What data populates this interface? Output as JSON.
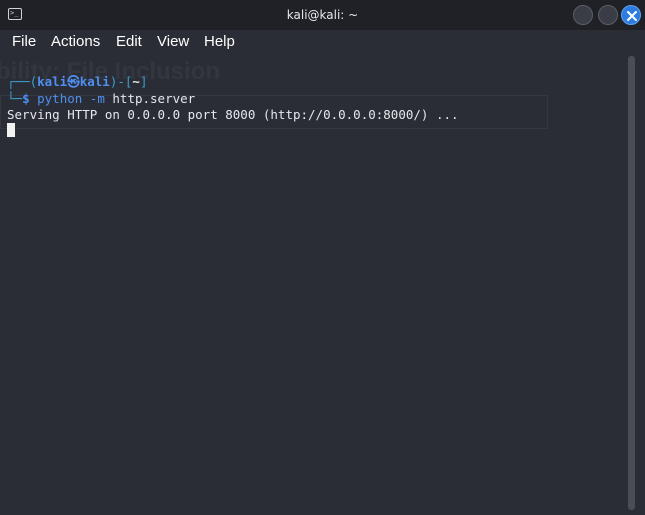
{
  "window": {
    "title": "kali@kali: ~",
    "buttons": {
      "minimize": "minimize-icon",
      "maximize": "maximize-icon",
      "close": "close-icon"
    }
  },
  "menu": {
    "file": "File",
    "actions": "Actions",
    "edit": "Edit",
    "view": "View",
    "help": "Help"
  },
  "background": {
    "ghost_title": "bility: File Inclusion"
  },
  "terminal": {
    "prompt": {
      "open": "┌──(",
      "user": "kali",
      "at": "㉿",
      "host": "kali",
      "mid": ")-[",
      "cwd": "~",
      "close": "]",
      "line2": "└─",
      "dollar": "$ "
    },
    "command": {
      "program": "python",
      "flag": " -m ",
      "arg": "http.server"
    },
    "output": "Serving HTTP on 0.0.0.0 port 8000 (http://0.0.0.0:8000/) ..."
  },
  "colors": {
    "accent": "#2f7ce0",
    "prompt_frame": "#3c9fc8",
    "prompt_user": "#4f8ff0",
    "background": "#2a2d35"
  }
}
